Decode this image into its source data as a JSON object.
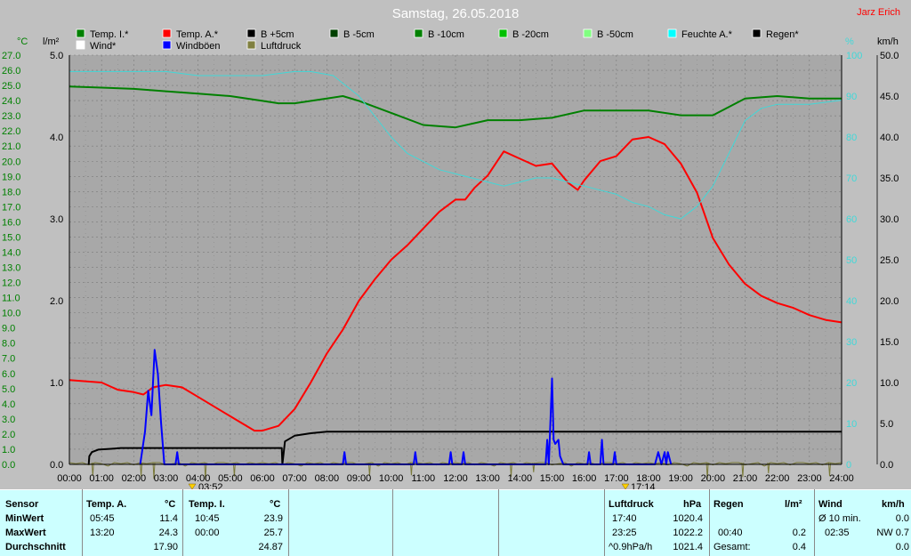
{
  "title": "Samstag, 26.05.2018",
  "author": "Jarz Erich",
  "axes": {
    "left_temp_unit": "°C",
    "left_rain_unit": "l/m²",
    "right_hum_unit": "%",
    "right_wind_unit": "km/h"
  },
  "colors": {
    "temp_inside": "#008000",
    "temp_outside": "#ff0000",
    "humidity": "#40d8d8",
    "gust": "#0000ff",
    "rain": "#000000",
    "pressure": "#7a7a3a",
    "grid": "#7a7a7a",
    "plot_bg": "#a8a8a8"
  },
  "legend": [
    {
      "label": "Temp. I.*",
      "color": "#008000"
    },
    {
      "label": "Temp. A.*",
      "color": "#ff0000"
    },
    {
      "label": "B +5cm",
      "color": "#000000"
    },
    {
      "label": "B -5cm",
      "color": "#004000"
    },
    {
      "label": "B -10cm",
      "color": "#008000"
    },
    {
      "label": "B -20cm",
      "color": "#00c000"
    },
    {
      "label": "B -50cm",
      "color": "#80ff80"
    },
    {
      "label": "Feuchte A.*",
      "color": "#00ffff"
    },
    {
      "label": "Regen*",
      "color": "#000000"
    },
    {
      "label": "Wind*",
      "color": "#ffffff"
    },
    {
      "label": "Windböen",
      "color": "#0000ff"
    },
    {
      "label": "Luftdruck",
      "color": "#808040"
    }
  ],
  "markers": [
    {
      "label": "03:52",
      "icon": "sunrise-icon"
    },
    {
      "label": "17:14",
      "icon": "sunset-icon"
    }
  ],
  "chart_data": {
    "type": "line",
    "title": "Samstag, 26.05.2018",
    "x_range": [
      0,
      24
    ],
    "x_ticks": [
      "00:00",
      "01:00",
      "02:00",
      "03:00",
      "04:00",
      "05:00",
      "06:00",
      "07:00",
      "08:00",
      "09:00",
      "10:00",
      "11:00",
      "12:00",
      "13:00",
      "14:00",
      "15:00",
      "16:00",
      "17:00",
      "18:00",
      "19:00",
      "20:00",
      "21:00",
      "22:00",
      "23:00",
      "24:00"
    ],
    "temp_axis": {
      "ylim": [
        10,
        27
      ],
      "ticks": [
        "27.0",
        "26.0",
        "25.0",
        "24.0",
        "23.0",
        "22.0",
        "21.0",
        "20.0",
        "19.0",
        "18.0",
        "17.0",
        "16.0",
        "15.0",
        "14.0",
        "13.0",
        "12.0",
        "11.0",
        "10.0",
        "9.0",
        "8.0",
        "7.0",
        "6.0",
        "5.0",
        "4.0",
        "3.0",
        "2.0",
        "1.0",
        "0.0"
      ]
    },
    "rain_axis": {
      "ylim": [
        0,
        5
      ],
      "ticks": [
        "5.0",
        "4.0",
        "3.0",
        "2.0",
        "1.0",
        "0.0"
      ]
    },
    "hum_axis": {
      "ylim": [
        0,
        100
      ],
      "ticks": [
        "100",
        "90",
        "80",
        "70",
        "60",
        "50",
        "40",
        "30",
        "20",
        "10",
        "0"
      ]
    },
    "wind_axis": {
      "ylim": [
        0,
        50
      ],
      "ticks": [
        "50.0",
        "45.0",
        "40.0",
        "35.0",
        "30.0",
        "25.0",
        "20.0",
        "15.0",
        "10.0",
        "5.0",
        "0.0"
      ]
    },
    "series": [
      {
        "name": "Temp. I.*",
        "axis": "temp",
        "color": "#008000",
        "x": [
          0,
          1,
          2,
          3,
          4,
          5,
          6,
          6.5,
          7,
          8,
          8.5,
          9,
          10,
          11,
          12,
          13,
          14,
          15,
          16,
          17,
          18,
          19,
          20,
          21,
          22,
          23,
          24
        ],
        "y": [
          25.7,
          25.65,
          25.6,
          25.5,
          25.4,
          25.3,
          25.1,
          25.0,
          25.0,
          25.2,
          25.3,
          25.1,
          24.6,
          24.1,
          24.0,
          24.3,
          24.3,
          24.4,
          24.7,
          24.7,
          24.7,
          24.5,
          24.5,
          25.2,
          25.3,
          25.2,
          25.2
        ]
      },
      {
        "name": "Temp. A.*",
        "axis": "temp",
        "color": "#ff0000",
        "x": [
          0,
          1,
          1.5,
          2,
          2.3,
          2.6,
          3,
          3.5,
          4,
          5,
          5.75,
          6,
          6.5,
          7,
          7.5,
          8,
          8.5,
          9,
          9.5,
          10,
          10.5,
          11,
          11.5,
          12,
          12.3,
          12.6,
          13,
          13.3,
          13.5,
          14,
          14.5,
          15,
          15.5,
          15.8,
          16,
          16.5,
          17,
          17.5,
          18,
          18.5,
          19,
          19.5,
          20,
          20.5,
          21,
          21.5,
          22,
          22.5,
          23,
          23.5,
          24
        ],
        "y": [
          13.5,
          13.4,
          13.1,
          13.0,
          12.9,
          13.2,
          13.3,
          13.2,
          12.8,
          12.0,
          11.4,
          11.4,
          11.6,
          12.3,
          13.4,
          14.6,
          15.6,
          16.8,
          17.7,
          18.5,
          19.1,
          19.8,
          20.5,
          21.0,
          21.0,
          21.5,
          22.0,
          22.6,
          23.0,
          22.7,
          22.4,
          22.5,
          21.7,
          21.4,
          21.8,
          22.6,
          22.8,
          23.5,
          23.6,
          23.3,
          22.5,
          21.3,
          19.4,
          18.3,
          17.5,
          17.0,
          16.7,
          16.5,
          16.2,
          16.0,
          15.9
        ]
      },
      {
        "name": "Feuchte A.*",
        "axis": "hum",
        "color": "#40d8d8",
        "x": [
          0,
          1,
          2,
          3,
          4,
          5,
          6,
          7,
          7.5,
          8.2,
          9,
          9.5,
          10,
          10.5,
          11,
          11.5,
          12,
          12.5,
          13,
          13.5,
          14,
          14.5,
          15,
          15.5,
          16,
          16.5,
          17,
          17.5,
          18,
          18.5,
          19,
          19.5,
          20,
          20.5,
          21,
          21.5,
          22,
          23,
          24
        ],
        "y": [
          96,
          96,
          96,
          96,
          95,
          95,
          95,
          96,
          96,
          95,
          90,
          85,
          80,
          76,
          74,
          72,
          71,
          70,
          69,
          68,
          69,
          70,
          70,
          69,
          68,
          67,
          66,
          64,
          63,
          61,
          60,
          63,
          68,
          76,
          84,
          87,
          88,
          88,
          89
        ]
      },
      {
        "name": "Luftdruck",
        "axis": "pressure",
        "color": "#7a7a3a",
        "x": [
          0,
          24
        ],
        "y": [
          1021.4,
          1021.4
        ]
      },
      {
        "name": "Regen*",
        "axis": "rain",
        "color": "#000000",
        "x": [
          0.6,
          0.62,
          0.7,
          0.9,
          1.3,
          1.6,
          2.0,
          3.0,
          4.0,
          5.0,
          6.0,
          6.6,
          6.62,
          6.7,
          7.0,
          7.5,
          8.0,
          9.0,
          12.0,
          15.0,
          18.0,
          21.0,
          24.0
        ],
        "y": [
          0.0,
          0.1,
          0.15,
          0.18,
          0.19,
          0.2,
          0.2,
          0.2,
          0.2,
          0.2,
          0.2,
          0.2,
          0.0,
          0.28,
          0.35,
          0.38,
          0.4,
          0.4,
          0.4,
          0.4,
          0.4,
          0.4,
          0.4
        ]
      },
      {
        "name": "Windböen",
        "axis": "wind",
        "color": "#0000ff",
        "x": [
          2.2,
          2.35,
          2.45,
          2.55,
          2.65,
          2.75,
          2.85,
          2.95,
          3.3,
          3.35,
          3.4,
          8.5,
          8.55,
          8.6,
          10.7,
          10.75,
          10.8,
          11.8,
          11.85,
          11.9,
          12.2,
          12.25,
          12.3,
          14.8,
          14.85,
          14.9,
          15.0,
          15.05,
          15.1,
          15.2,
          15.25,
          15.35,
          16.1,
          16.15,
          16.2,
          16.5,
          16.55,
          16.6,
          16.9,
          16.95,
          17.0,
          18.2,
          18.3,
          18.4,
          18.5,
          18.55,
          18.6,
          18.7
        ],
        "y": [
          0,
          4,
          9,
          6,
          14,
          11,
          5,
          0,
          0,
          1.5,
          0,
          0,
          1.5,
          0,
          0,
          1.5,
          0,
          0,
          1.5,
          0,
          0,
          1.5,
          0,
          0,
          3,
          0,
          10.5,
          3,
          2.5,
          3,
          1,
          0,
          0,
          1.5,
          0,
          0,
          3,
          0,
          0,
          1.5,
          0,
          0,
          1.5,
          0,
          1.5,
          0,
          1.5,
          0
        ]
      }
    ]
  },
  "table": {
    "sensor_label": "Sensor",
    "row_labels": [
      "MinWert",
      "MaxWert",
      "Durchschnitt"
    ],
    "temp_a": {
      "header": "Temp. A.",
      "unit": "°C",
      "times": [
        "05:45",
        "13:20"
      ],
      "values": [
        "11.4",
        "24.3",
        "17.90"
      ]
    },
    "temp_i": {
      "header": "Temp. I.",
      "unit": "°C",
      "times": [
        "10:45",
        "00:00"
      ],
      "values": [
        "23.9",
        "25.7",
        "24.87"
      ]
    },
    "pressure": {
      "header": "Luftdruck",
      "unit": "hPa",
      "times": [
        "17:40",
        "23:25",
        "^0.9hPa/h"
      ],
      "values": [
        "1020.4",
        "1022.2",
        "1021.4"
      ]
    },
    "rain": {
      "header": "Regen",
      "unit": "l/m²",
      "times": [
        "",
        "00:40",
        "Gesamt:"
      ],
      "values": [
        "",
        "0.2",
        "0.4"
      ]
    },
    "wind": {
      "header": "Wind",
      "unit": "km/h",
      "times": [
        "Ø 10 min.",
        "02:35",
        ""
      ],
      "values": [
        "0.0",
        "NW 0.7",
        "0.0"
      ]
    }
  }
}
